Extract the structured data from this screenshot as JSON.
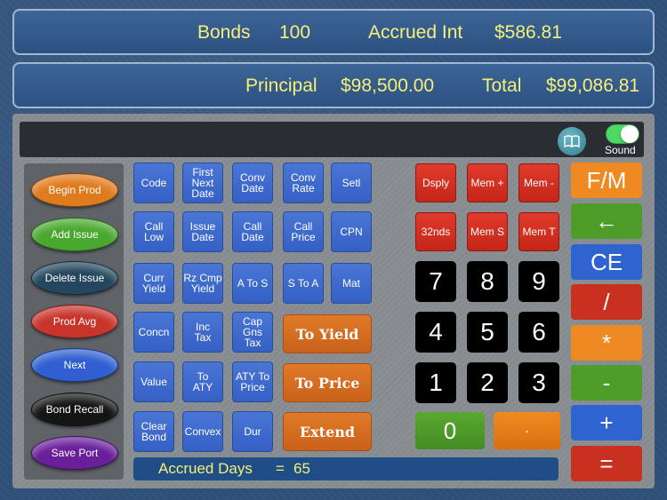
{
  "header": {
    "bonds_label": "Bonds",
    "bonds_value": "100",
    "accrued_int_label": "Accrued Int",
    "accrued_int_value": "$586.81",
    "principal_label": "Principal",
    "principal_value": "$98,500.00",
    "total_label": "Total",
    "total_value": "$99,086.81"
  },
  "toolbar": {
    "book_icon": "book-icon",
    "sound_label": "Sound",
    "sound_on": true
  },
  "side_buttons": [
    {
      "label": "Begin Prod",
      "color": "#e07a1e"
    },
    {
      "label": "Add Issue",
      "color": "#49a82e"
    },
    {
      "label": "Delete Issue",
      "color": "#24475e"
    },
    {
      "label": "Prod  Avg",
      "color": "#c8342a"
    },
    {
      "label": "Next",
      "color": "#2f5fd0"
    },
    {
      "label": "Bond Recall",
      "color": "#151515"
    },
    {
      "label": "Save Port",
      "color": "#6a1f9a"
    }
  ],
  "function_keys": [
    [
      "Code",
      "First\nNext\nDate",
      "Conv\nDate",
      "Conv\nRate",
      "Setl"
    ],
    [
      "Call\nLow",
      "Issue\nDate",
      "Call\nDate",
      "Call\nPrice",
      "CPN"
    ],
    [
      "Curr\nYield",
      "Rz Cmp\nYield",
      "A To S",
      "S To A",
      "Mat"
    ],
    [
      "Concn",
      "Inc\nTax",
      "Cap\nGns\nTax"
    ],
    [
      "Value",
      "To\nATY",
      "ATY To\nPrice"
    ],
    [
      "Clear\nBond",
      "Convex",
      "Dur"
    ]
  ],
  "action_buttons": [
    "To Yield",
    "To Price",
    "Extend"
  ],
  "accrued_days": {
    "label": "Accrued Days",
    "equals": "=",
    "value": "65"
  },
  "memory_keys": [
    "Dsply",
    "Mem +",
    "Mem -",
    "32nds",
    "Mem S",
    "Mem T"
  ],
  "digits": [
    "7",
    "8",
    "9",
    "4",
    "5",
    "6",
    "1",
    "2",
    "3"
  ],
  "zero": "0",
  "decimal": "·",
  "operators": [
    {
      "label": "F/M",
      "color": "#ef8a22"
    },
    {
      "label": "←",
      "color": "#4e9c2a"
    },
    {
      "label": "CE",
      "color": "#2f63cf"
    },
    {
      "label": "/",
      "color": "#c83020"
    },
    {
      "label": "*",
      "color": "#ef8a22"
    },
    {
      "label": "-",
      "color": "#4e9c2a"
    },
    {
      "label": "+",
      "color": "#2f63cf"
    },
    {
      "label": "=",
      "color": "#c83020"
    }
  ]
}
